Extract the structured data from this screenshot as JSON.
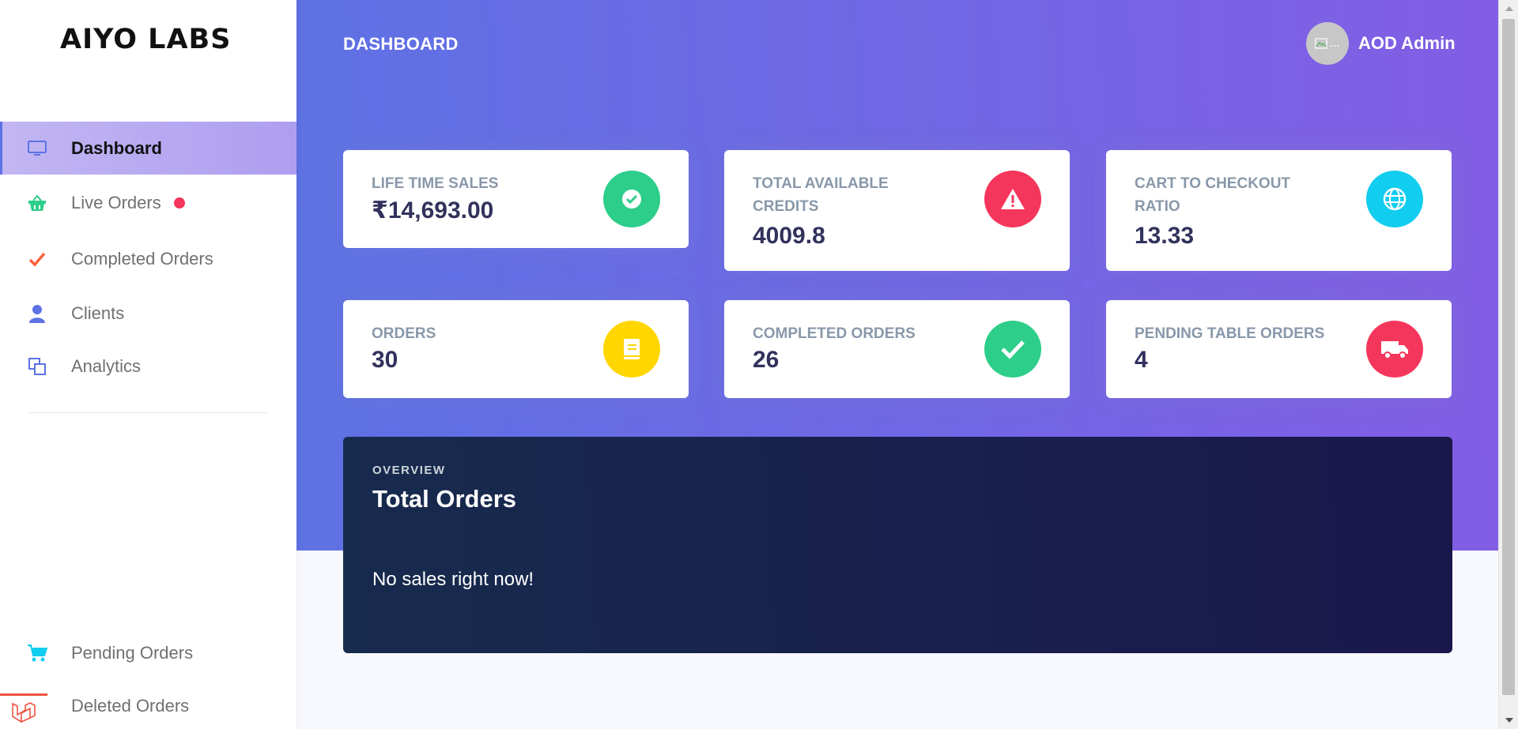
{
  "brand": {
    "name": "AIYO LABS"
  },
  "sidebar": {
    "items": [
      {
        "label": "Dashboard",
        "icon": "monitor-icon",
        "active": true
      },
      {
        "label": "Live Orders",
        "icon": "basket-icon",
        "badge": "live-dot"
      },
      {
        "label": "Completed Orders",
        "icon": "check-icon"
      },
      {
        "label": "Clients",
        "icon": "user-icon"
      },
      {
        "label": "Analytics",
        "icon": "copy-icon"
      }
    ],
    "bottom_items": [
      {
        "label": "Pending Orders",
        "icon": "cart-icon"
      },
      {
        "label": "Deleted Orders",
        "icon": "trash-icon"
      }
    ]
  },
  "header": {
    "title": "DASHBOARD",
    "user": {
      "name": "AOD Admin",
      "avatar_alt": "..."
    }
  },
  "stats": [
    {
      "label": "LIFE TIME SALES",
      "value": "₹14,693.00",
      "icon": "check-circle-icon",
      "color": "#2dce89"
    },
    {
      "label": "TOTAL AVAILABLE CREDITS",
      "value": "4009.8",
      "icon": "warning-icon",
      "color": "#f5365c"
    },
    {
      "label": "CART TO CHECKOUT RATIO",
      "value": "13.33",
      "icon": "globe-icon",
      "color": "#11cdef"
    },
    {
      "label": "ORDERS",
      "value": "30",
      "icon": "book-icon",
      "color": "#ffd600"
    },
    {
      "label": "COMPLETED ORDERS",
      "value": "26",
      "icon": "check-icon",
      "color": "#2dce89"
    },
    {
      "label": "PENDING TABLE ORDERS",
      "value": "4",
      "icon": "truck-icon",
      "color": "#f5365c"
    }
  ],
  "overview": {
    "subtitle": "OVERVIEW",
    "title": "Total Orders",
    "empty_message": "No sales right now!"
  }
}
